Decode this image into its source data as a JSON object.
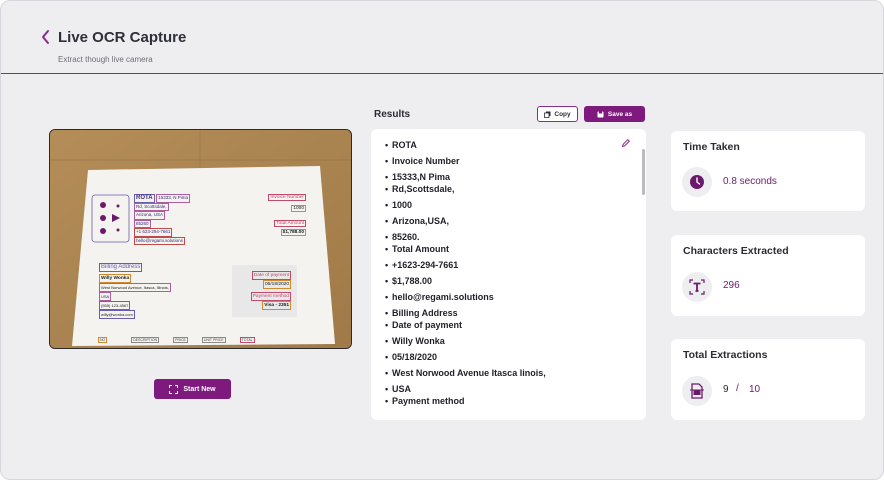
{
  "header": {
    "title": "Live OCR Capture",
    "subtitle": "Extract though live camera"
  },
  "camera": {
    "document": {
      "company": "ROTA",
      "company_address_lines": [
        "15333, N Pima",
        "Rd, Scottsdale,",
        "Arizona, USA",
        "85260"
      ],
      "phone": "+1 623-294-7661",
      "email": "hello@regami.solutions",
      "invoice_number_label": "Invoice Number",
      "invoice_number": "1000",
      "total_amount_label": "Total Amount",
      "total_amount": "$1,788.00",
      "billing_address_label": "Billing Address",
      "customer_name": "Willy Wonka",
      "customer_address_lines": [
        "West Norwood Avenue, Itasca, Illinois,",
        "USA"
      ],
      "customer_phone": "(555) 123-4567",
      "customer_email": "willy@wonka.com",
      "date_label": "Date of payment",
      "date": "05/18/2020",
      "method_label": "Payment method",
      "method": "Visa - 2351",
      "table_headers": [
        "NO",
        "DESCRIPTION",
        "PRICE",
        "UNIT PRICE",
        "TOTAL"
      ]
    },
    "start_button_label": "Start New"
  },
  "results": {
    "title": "Results",
    "copy_label": "Copy",
    "save_label": "Save as",
    "items": [
      "ROTA",
      "Invoice Number",
      "15333,N Pima",
      "Rd,Scottsdale,",
      "1000",
      "Arizona,USA,",
      "85260.",
      "Total Amount",
      "+1623-294-7661",
      "$1,788.00",
      "hello@regami.solutions",
      "Billing Address",
      "Date of payment",
      "Willy Wonka",
      "05/18/2020",
      "West Norwood Avenue Itasca linois,",
      "USA",
      "Payment method"
    ]
  },
  "stats": {
    "time": {
      "title": "Time Taken",
      "value": "0.8 seconds",
      "icon": "clock-icon"
    },
    "characters": {
      "title": "Characters Extracted",
      "value": "296",
      "icon": "text-scan-icon"
    },
    "extractions": {
      "title": "Total Extractions",
      "used": "9",
      "separator": "/",
      "total": "10",
      "icon": "document-scan-icon"
    }
  },
  "colors": {
    "accent": "#7e1a7e",
    "background": "#eeeef1",
    "card": "#ffffff"
  }
}
